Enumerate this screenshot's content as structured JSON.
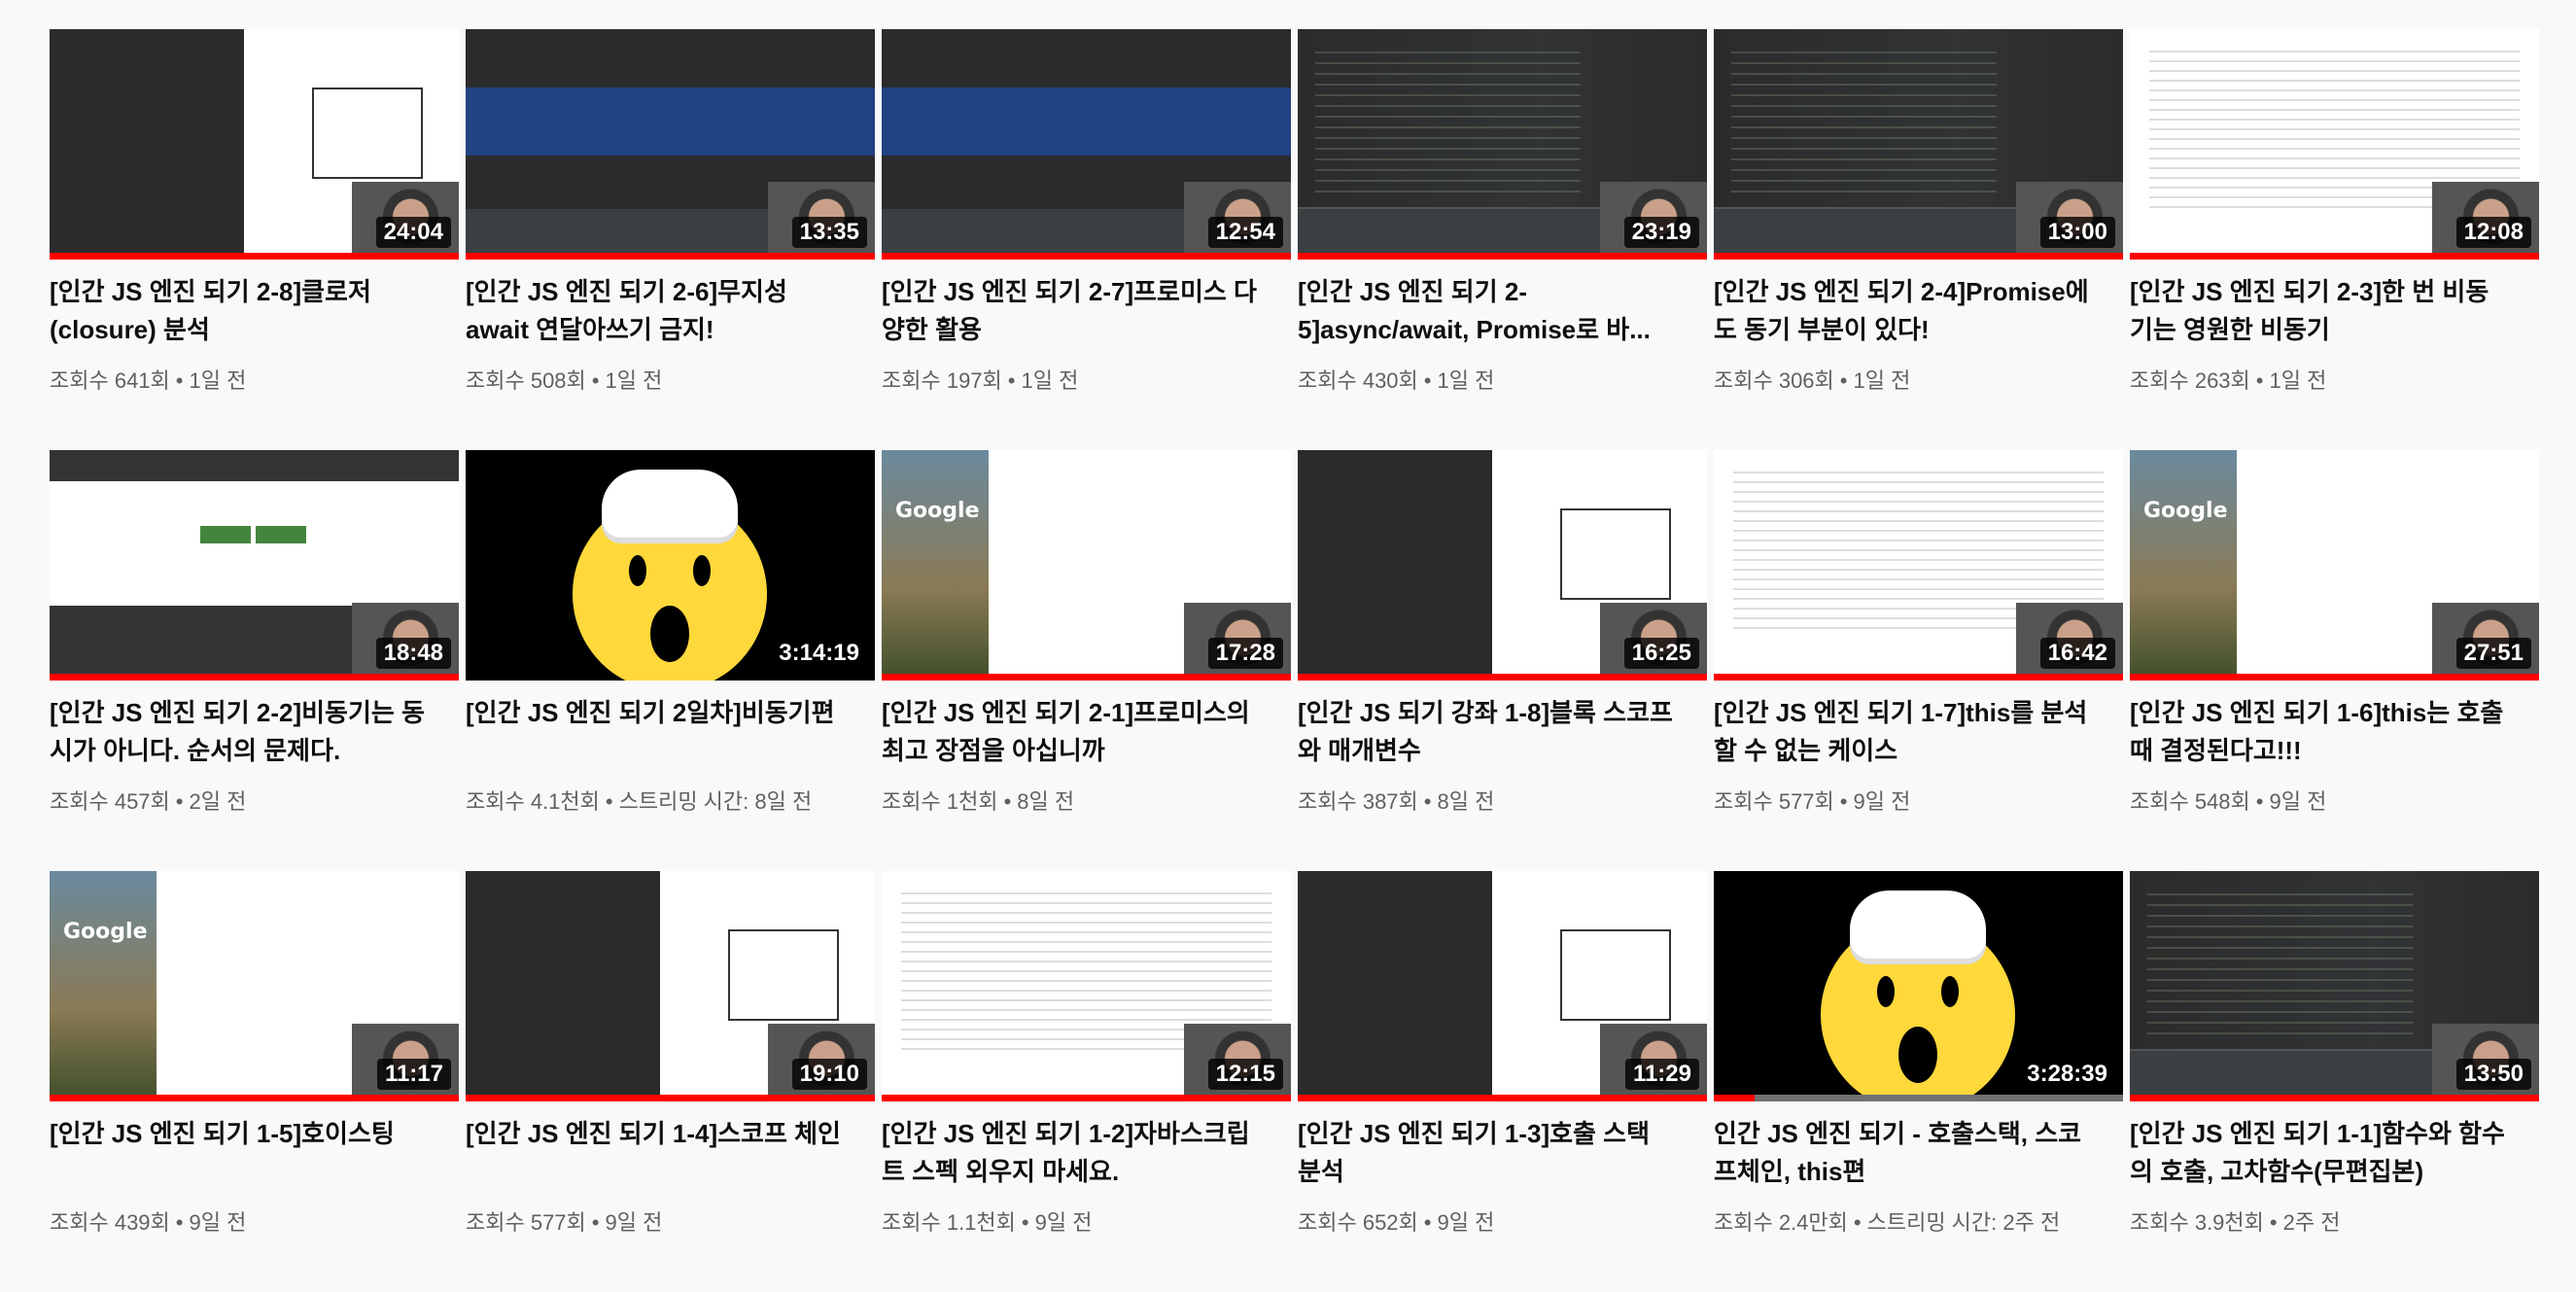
{
  "videos": [
    {
      "title": "[인간 JS 엔진 되기 2-8]클로저(closure) 분석",
      "views": "조회수 641회",
      "age": "1일 전",
      "duration": "24:04",
      "watched": 1.0,
      "thumb": "split",
      "thumb_icon": "ide-screenshot"
    },
    {
      "title": "[인간 JS 엔진 되기 2-6]무지성 await 연달아쓰기 금지!",
      "views": "조회수 508회",
      "age": "1일 전",
      "duration": "13:35",
      "watched": 1.0,
      "thumb": "blue",
      "thumb_icon": "ide-screenshot"
    },
    {
      "title": "[인간 JS 엔진 되기 2-7]프로미스 다양한 활용",
      "views": "조회수 197회",
      "age": "1일 전",
      "duration": "12:54",
      "watched": 1.0,
      "thumb": "blue",
      "thumb_icon": "ide-screenshot"
    },
    {
      "title": "[인간 JS 엔진 되기 2-5]async/await, Promise로 바...",
      "views": "조회수 430회",
      "age": "1일 전",
      "duration": "23:19",
      "watched": 1.0,
      "thumb": "ide",
      "thumb_icon": "ide-screenshot"
    },
    {
      "title": "[인간 JS 엔진 되기 2-4]Promise에도 동기 부분이 있다!",
      "views": "조회수 306회",
      "age": "1일 전",
      "duration": "13:00",
      "watched": 1.0,
      "thumb": "ide",
      "thumb_icon": "ide-screenshot"
    },
    {
      "title": "[인간 JS 엔진 되기 2-3]한 번 비동기는 영원한 비동기",
      "views": "조회수 263회",
      "age": "1일 전",
      "duration": "12:08",
      "watched": 1.0,
      "thumb": "white",
      "thumb_icon": "document-screenshot"
    },
    {
      "title": "[인간 JS 엔진 되기 2-2]비동기는 동시가 아니다. 순서의 문제다.",
      "views": "조회수 457회",
      "age": "2일 전",
      "duration": "18:48",
      "watched": 1.0,
      "thumb": "node",
      "thumb_icon": "nodejs-website"
    },
    {
      "title": "[인간 JS 엔진 되기 2일차]비동기편",
      "views": "조회수 4.1천회",
      "age": "스트리밍 시간: 8일 전",
      "duration": "3:14:19",
      "watched": 0.0,
      "thumb": "emoji",
      "thumb_icon": "exploding-head-emoji"
    },
    {
      "title": "[인간 JS 엔진 되기 2-1]프로미스의 최고 장점을 아십니까",
      "views": "조회수 1천회",
      "age": "8일 전",
      "duration": "17:28",
      "watched": 1.0,
      "thumb": "google",
      "thumb_icon": "browser-screenshot"
    },
    {
      "title": "[인간 JS 되기 강좌 1-8]블록 스코프와 매개변수",
      "views": "조회수 387회",
      "age": "8일 전",
      "duration": "16:25",
      "watched": 1.0,
      "thumb": "split",
      "thumb_icon": "ide-screenshot"
    },
    {
      "title": "[인간 JS 엔진 되기 1-7]this를 분석할 수 없는 케이스",
      "views": "조회수 577회",
      "age": "9일 전",
      "duration": "16:42",
      "watched": 1.0,
      "thumb": "white",
      "thumb_icon": "devtools-screenshot"
    },
    {
      "title": "[인간 JS 엔진 되기 1-6]this는 호출 때 결정된다고!!!",
      "views": "조회수 548회",
      "age": "9일 전",
      "duration": "27:51",
      "watched": 1.0,
      "thumb": "google",
      "thumb_icon": "browser-screenshot"
    },
    {
      "title": "[인간 JS 엔진 되기 1-5]호이스팅",
      "views": "조회수 439회",
      "age": "9일 전",
      "duration": "11:17",
      "watched": 1.0,
      "thumb": "google",
      "thumb_icon": "browser-screenshot"
    },
    {
      "title": "[인간 JS 엔진 되기 1-4]스코프 체인",
      "views": "조회수 577회",
      "age": "9일 전",
      "duration": "19:10",
      "watched": 1.0,
      "thumb": "split",
      "thumb_icon": "ide-screenshot"
    },
    {
      "title": "[인간 JS 엔진 되기 1-2]자바스크립트 스펙 외우지 마세요.",
      "views": "조회수 1.1천회",
      "age": "9일 전",
      "duration": "12:15",
      "watched": 1.0,
      "thumb": "white",
      "thumb_icon": "spec-screenshot"
    },
    {
      "title": "[인간 JS 엔진 되기 1-3]호출 스택 분석",
      "views": "조회수 652회",
      "age": "9일 전",
      "duration": "11:29",
      "watched": 1.0,
      "thumb": "split",
      "thumb_icon": "ide-screenshot"
    },
    {
      "title": "인간 JS 엔진 되기 - 호출스택, 스코프체인, this편",
      "views": "조회수 2.4만회",
      "age": "스트리밍 시간: 2주 전",
      "duration": "3:28:39",
      "watched": 0.1,
      "thumb": "emoji",
      "thumb_icon": "exploding-head-emoji"
    },
    {
      "title": "[인간 JS 엔진 되기 1-1]함수와 함수의 호출, 고차함수(무편집본)",
      "views": "조회수 3.9천회",
      "age": "2주 전",
      "duration": "13:50",
      "watched": 1.0,
      "thumb": "ide",
      "thumb_icon": "ide-screenshot"
    }
  ],
  "colors": {
    "progress": "#ff0000",
    "track": "#717171",
    "meta": "#606060",
    "title": "#0f0f0f"
  }
}
